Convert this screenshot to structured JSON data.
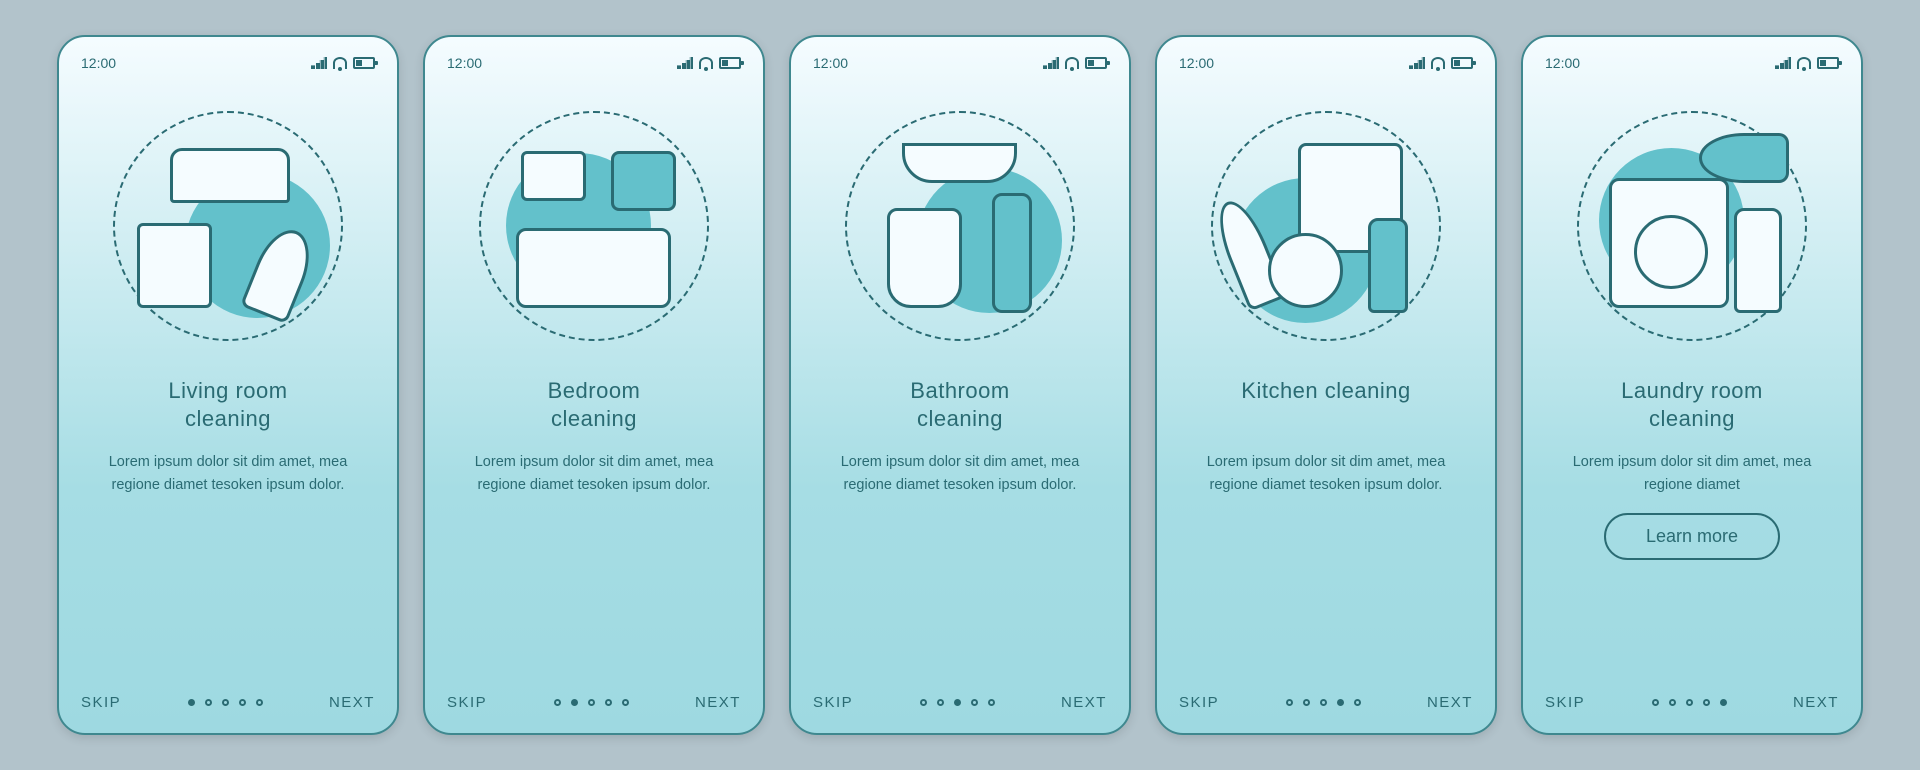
{
  "status": {
    "time": "12:00"
  },
  "nav": {
    "skip": "SKIP",
    "next": "NEXT"
  },
  "learnMore": "Learn more",
  "screens": [
    {
      "title": "Living room\ncleaning",
      "desc": "Lorem ipsum dolor sit dim amet, mea regione diamet tesoken ipsum dolor.",
      "icon": "living-room-icon",
      "activeDot": 0,
      "hasLearnMore": false
    },
    {
      "title": "Bedroom\ncleaning",
      "desc": "Lorem ipsum dolor sit dim amet, mea regione diamet tesoken ipsum dolor.",
      "icon": "bedroom-icon",
      "activeDot": 1,
      "hasLearnMore": false
    },
    {
      "title": "Bathroom\ncleaning",
      "desc": "Lorem ipsum dolor sit dim amet, mea regione diamet tesoken ipsum dolor.",
      "icon": "bathroom-icon",
      "activeDot": 2,
      "hasLearnMore": false
    },
    {
      "title": "Kitchen cleaning",
      "desc": "Lorem ipsum dolor sit dim amet, mea regione diamet tesoken ipsum dolor.",
      "icon": "kitchen-icon",
      "activeDot": 3,
      "hasLearnMore": false
    },
    {
      "title": "Laundry room\ncleaning",
      "desc": "Lorem ipsum dolor sit dim amet, mea regione diamet",
      "icon": "laundry-icon",
      "activeDot": 4,
      "hasLearnMore": true
    }
  ]
}
